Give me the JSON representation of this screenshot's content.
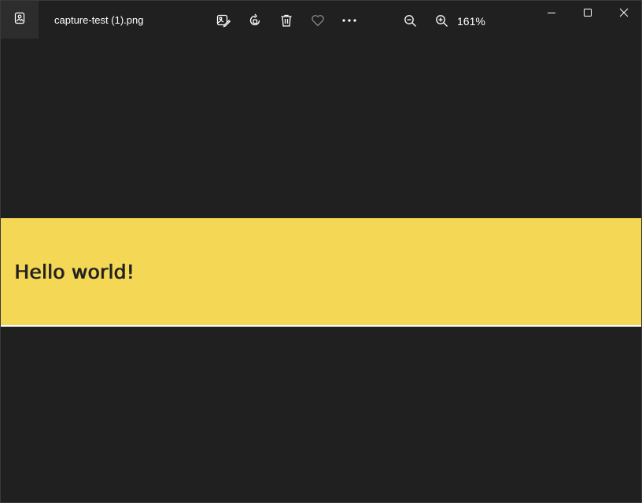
{
  "titlebar": {
    "file_name": "capture-test (1).png",
    "zoom_label": "161%",
    "icons": {
      "app": "photos-app-icon",
      "edit": "edit-image-icon",
      "rotate": "rotate-icon",
      "delete": "delete-icon",
      "favorite": "heart-icon",
      "more": "more-icon",
      "zoom_out": "zoom-out-icon",
      "zoom_in": "zoom-in-icon",
      "minimize": "minimize-icon",
      "maximize": "maximize-icon",
      "close": "close-icon"
    }
  },
  "image": {
    "text": "Hello world!",
    "band_color": "#f4d755"
  },
  "colors": {
    "background": "#202020",
    "titlebar": "#202020",
    "icon": "#ffffff",
    "disabled_icon": "#8a8a8a"
  }
}
